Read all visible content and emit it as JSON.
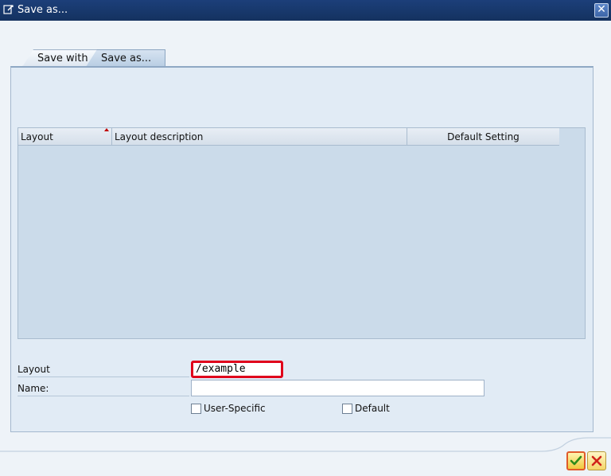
{
  "window": {
    "title": "Save as...",
    "close_icon": "close-icon"
  },
  "tabs": [
    {
      "label": "Save with",
      "active": false
    },
    {
      "label": "Save as...",
      "active": true
    }
  ],
  "table": {
    "columns": [
      "Layout",
      "Layout description",
      "Default Setting"
    ],
    "rows": []
  },
  "form": {
    "layout_label": "Layout",
    "layout_value": "/example",
    "name_label": "Name:",
    "name_value": "",
    "user_specific_label": "User-Specific",
    "user_specific_checked": false,
    "default_label": "Default",
    "default_checked": false
  },
  "buttons": {
    "ok_icon": "check-icon",
    "cancel_icon": "cancel-x-icon"
  },
  "colors": {
    "title_bar": "#1c3f7a",
    "highlight": "#e0001b",
    "panel": "#e1ebf5",
    "table": "#cbdbea"
  }
}
